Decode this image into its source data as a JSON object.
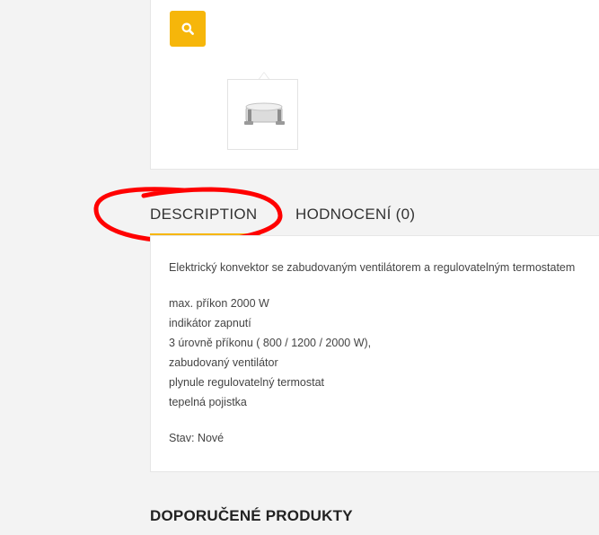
{
  "gallery": {
    "zoom_icon": "search-icon",
    "thumbnail_icon": "convector-heater-thumbnail",
    "accent_color": "#f6b60a"
  },
  "tabs": [
    {
      "label": "DESCRIPTION",
      "active": true
    },
    {
      "label": "HODNOCENÍ (0)",
      "active": false
    }
  ],
  "description": {
    "intro": "Elektrický konvektor se zabudovaným ventilátorem a regulovatelným termostatem",
    "features": [
      "max. příkon 2000 W",
      "indikátor zapnutí",
      "3 úrovně příkonu ( 800 / 1200 / 2000 W),",
      "zabudovaný ventilátor",
      "plynule regulovatelný termostat",
      "tepelná pojistka"
    ],
    "condition": "Stav: Nové"
  },
  "related": {
    "title": "DOPORUČENÉ PRODUKTY"
  },
  "annotation_color": "#ff0000"
}
